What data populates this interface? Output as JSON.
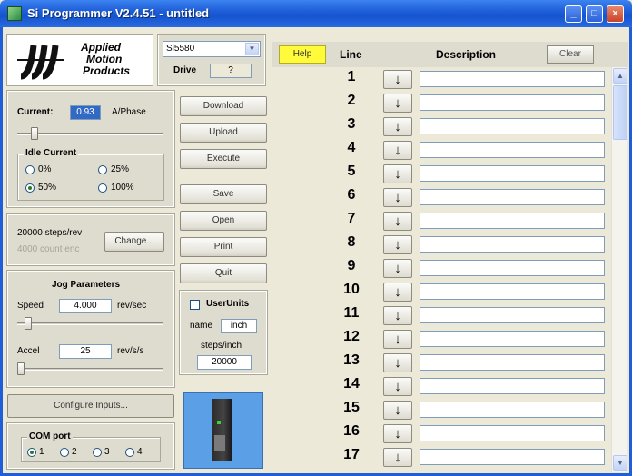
{
  "window": {
    "title": "Si Programmer  V2.4.51 - untitled",
    "buttons": [
      "_",
      "□",
      "×"
    ]
  },
  "logo": {
    "line1": "Applied",
    "line2": "Motion",
    "line3": "Products"
  },
  "drive": {
    "model_selected": "Si5580",
    "label": "Drive",
    "value": "?"
  },
  "current": {
    "label": "Current:",
    "value": "0.93",
    "unit": "A/Phase",
    "slider_level": 0.1
  },
  "idle_current": {
    "legend": "Idle Current",
    "options": [
      "0%",
      "25%",
      "50%",
      "100%"
    ],
    "selected": "50%"
  },
  "steps": {
    "steps_label": "20000 steps/rev",
    "encoder_label": "4000 count enc",
    "change_button": "Change..."
  },
  "jog": {
    "legend": "Jog Parameters",
    "speed_label": "Speed",
    "speed_value": "4.000",
    "speed_unit": "rev/sec",
    "speed_level": 0.05,
    "accel_label": "Accel",
    "accel_value": "25",
    "accel_unit": "rev/s/s",
    "accel_level": 0.0
  },
  "configure_inputs_button": "Configure Inputs...",
  "com_port": {
    "legend": "COM port",
    "options": [
      "1",
      "2",
      "3",
      "4"
    ],
    "selected": "1"
  },
  "actions": [
    "Download",
    "Upload",
    "Execute",
    "Save",
    "Open",
    "Print",
    "Quit"
  ],
  "user_units": {
    "label": "UserUnits",
    "checked": false,
    "name_label": "name",
    "name_value": "inch",
    "steps_label": "steps/inch",
    "steps_value": "20000"
  },
  "grid": {
    "help_button": "Help",
    "line_header": "Line",
    "description_header": "Description",
    "clear_button": "Clear",
    "lines": [
      "1",
      "2",
      "3",
      "4",
      "5",
      "6",
      "7",
      "8",
      "9",
      "10",
      "11",
      "12",
      "13",
      "14",
      "15",
      "16",
      "17"
    ],
    "arrow_icon": "down-arrow-icon",
    "arrow_glyph": "↓"
  },
  "colors": {
    "title_bar": "#1f5ed8",
    "help_button": "#fffa3a",
    "image_bg": "#5b9fe6"
  }
}
